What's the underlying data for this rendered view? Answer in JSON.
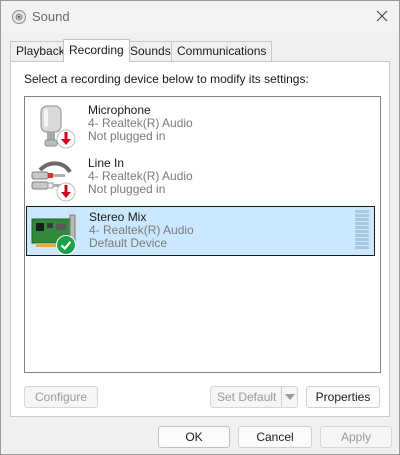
{
  "window": {
    "title": "Sound"
  },
  "tabs": [
    {
      "label": "Playback"
    },
    {
      "label": "Recording",
      "active": true
    },
    {
      "label": "Sounds"
    },
    {
      "label": "Communications"
    }
  ],
  "recording": {
    "instruction": "Select a recording device below to modify its settings:",
    "devices": [
      {
        "name": "Microphone",
        "driver": "4- Realtek(R) Audio",
        "status": "Not plugged in",
        "icon": "microphone-icon",
        "badge": "unplugged-arrow-icon"
      },
      {
        "name": "Line In",
        "driver": "4- Realtek(R) Audio",
        "status": "Not plugged in",
        "icon": "line-in-cable-icon",
        "badge": "unplugged-arrow-icon"
      },
      {
        "name": "Stereo Mix",
        "driver": "4- Realtek(R) Audio",
        "status": "Default Device",
        "icon": "sound-card-icon",
        "badge": "default-check-icon",
        "selected": true
      }
    ]
  },
  "buttons": {
    "configure": "Configure",
    "set_default": "Set Default",
    "properties": "Properties",
    "ok": "OK",
    "cancel": "Cancel",
    "apply": "Apply"
  },
  "colors": {
    "selection_bg": "#cce8ff",
    "unplugged_red": "#d0021b",
    "default_green": "#16a34a"
  }
}
